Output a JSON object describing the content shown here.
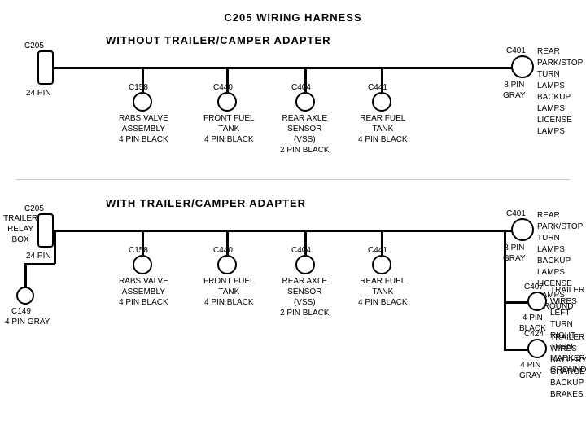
{
  "title": "C205 WIRING HARNESS",
  "section1": {
    "label": "WITHOUT  TRAILER/CAMPER  ADAPTER",
    "connectors": [
      {
        "id": "C205_1",
        "label": "C205",
        "sublabel": "24 PIN"
      },
      {
        "id": "C401_1",
        "label": "C401",
        "sublabel": "8 PIN\nGRAY"
      },
      {
        "id": "C158_1",
        "label": "C158",
        "sublabel": "RABS VALVE\nASSEMBLY\n4 PIN BLACK"
      },
      {
        "id": "C440_1",
        "label": "C440",
        "sublabel": "FRONT FUEL\nTANK\n4 PIN BLACK"
      },
      {
        "id": "C404_1",
        "label": "C404",
        "sublabel": "REAR AXLE\nSENSOR\n(VSS)\n2 PIN BLACK"
      },
      {
        "id": "C441_1",
        "label": "C441",
        "sublabel": "REAR FUEL\nTANK\n4 PIN BLACK"
      }
    ],
    "right_label": "REAR PARK/STOP\nTURN LAMPS\nBACKUP LAMPS\nLICENSE LAMPS"
  },
  "section2": {
    "label": "WITH  TRAILER/CAMPER  ADAPTER",
    "connectors": [
      {
        "id": "C205_2",
        "label": "C205",
        "sublabel": "24 PIN"
      },
      {
        "id": "C401_2",
        "label": "C401",
        "sublabel": "8 PIN\nGRAY"
      },
      {
        "id": "C158_2",
        "label": "C158",
        "sublabel": "RABS VALVE\nASSEMBLY\n4 PIN BLACK"
      },
      {
        "id": "C440_2",
        "label": "C440",
        "sublabel": "FRONT FUEL\nTANK\n4 PIN BLACK"
      },
      {
        "id": "C404_2",
        "label": "C404",
        "sublabel": "REAR AXLE\nSENSOR\n(VSS)\n2 PIN BLACK"
      },
      {
        "id": "C441_2",
        "label": "C441",
        "sublabel": "REAR FUEL\nTANK\n4 PIN BLACK"
      },
      {
        "id": "C149",
        "label": "C149",
        "sublabel": "4 PIN GRAY"
      },
      {
        "id": "C407",
        "label": "C407",
        "sublabel": "4 PIN\nBLACK"
      },
      {
        "id": "C424",
        "label": "C424",
        "sublabel": "4 PIN\nGRAY"
      }
    ],
    "right_label1": "REAR PARK/STOP\nTURN LAMPS\nBACKUP LAMPS\nLICENSE LAMPS\nGROUND",
    "right_label2": "TRAILER WIRES\nLEFT TURN\nRIGHT TURN\nMARKER\nGROUND",
    "right_label3": "TRAILER WIRES\nBATTERY CHARGE\nBACKUP\nBRAKES",
    "trailer_relay": "TRAILER\nRELAY\nBOX"
  }
}
